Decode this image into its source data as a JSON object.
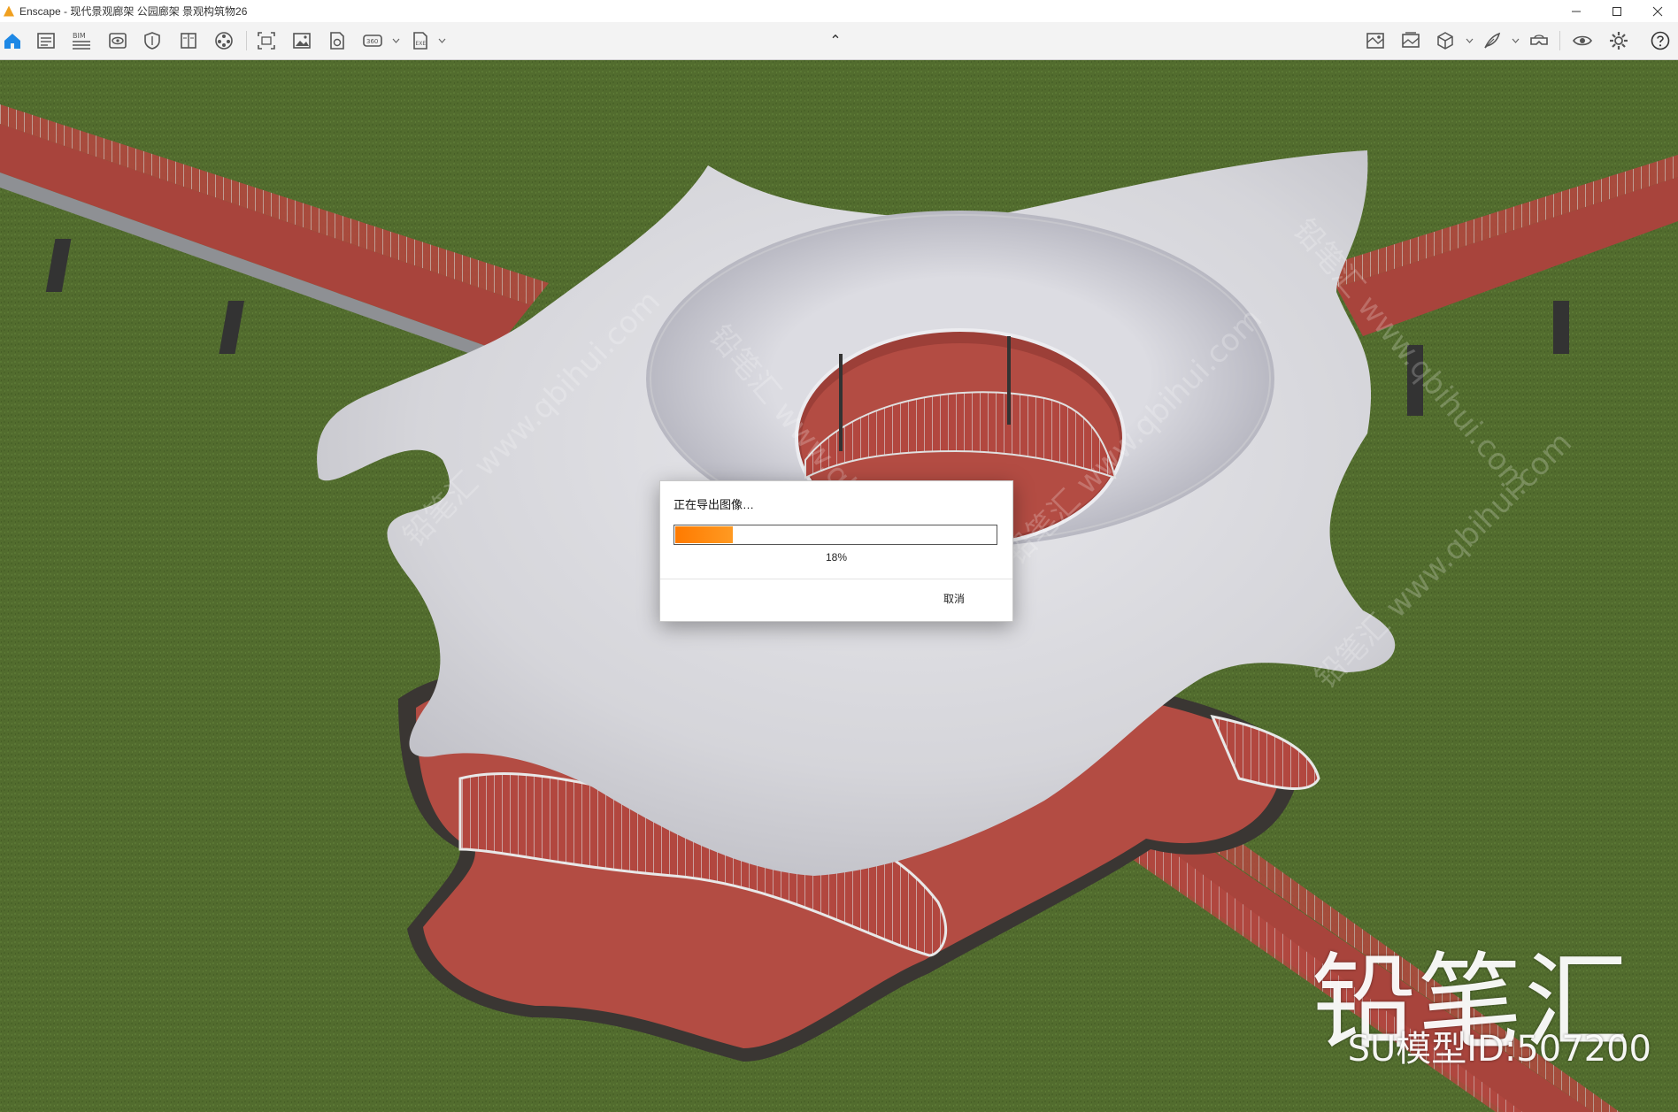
{
  "window": {
    "app_name": "Enscape",
    "title": "Enscape - 现代景观廊架 公园廊架 景观构筑物26",
    "controls": [
      "minimize",
      "maximize",
      "close"
    ]
  },
  "toolbar": {
    "left_icons": [
      "home-icon",
      "document-icon",
      "bim-icon",
      "eye-view-icon",
      "shield-icon",
      "book-icon",
      "film-reel-icon",
      "screenshot-icon",
      "image-icon",
      "export-file-icon",
      "vr-360-icon",
      "exe-export-icon"
    ],
    "bim_label": "BIM",
    "vr_label": "360",
    "exe_label": "EXE",
    "collapse_glyph": "⌃",
    "right_icons": [
      "map-icon",
      "gallery-icon",
      "cube-icon",
      "feather-icon",
      "vr-headset-icon",
      "visibility-icon",
      "settings-icon",
      "help-icon"
    ]
  },
  "dialog": {
    "message": "正在导出图像…",
    "progress": 0.18,
    "progress_text": "18%",
    "cancel_label": "取消"
  },
  "watermark": {
    "brand": "铅笔汇",
    "model_id": "SU模型ID:507200",
    "overlay_text": "铅笔汇 www.qbihui.com"
  },
  "colors": {
    "progress_fill": "#ff7a00",
    "grass": "#4f6b2c",
    "track_red": "#b2473f",
    "canopy": "#d8d8dc"
  }
}
